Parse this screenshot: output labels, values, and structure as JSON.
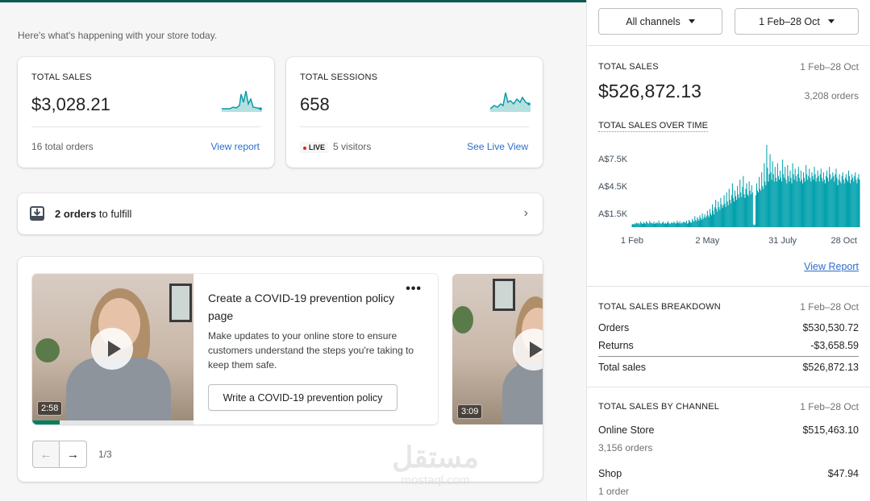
{
  "intro": "Here's what's happening with your store today.",
  "sales_card": {
    "label": "TOTAL SALES",
    "value": "$3,028.21",
    "footer": "16 total orders",
    "link": "View report"
  },
  "sessions_card": {
    "label": "TOTAL SESSIONS",
    "value": "658",
    "live_badge": "LIVE",
    "footer": "5 visitors",
    "link": "See Live View"
  },
  "fulfill": {
    "count_text": "2 orders",
    "rest_text": " to fulfill",
    "icon": "download-tray-icon"
  },
  "promo": {
    "title": "Create a COVID-19 prevention policy page",
    "description": "Make updates to your online store to ensure customers understand the steps you're taking to keep them safe.",
    "button": "Write a COVID-19 prevention policy",
    "video1_duration": "2:58",
    "video2_duration": "3:09",
    "more": "•••",
    "pager": "1/3",
    "prev": "←",
    "next": "→",
    "video_progress": 0.17
  },
  "filters": {
    "channel": "All channels",
    "date": "1 Feb–28 Oct"
  },
  "total_sales": {
    "label": "TOTAL SALES",
    "date": "1 Feb–28 Oct",
    "value": "$526,872.13",
    "orders": "3,208 orders",
    "chart_title": "TOTAL SALES OVER TIME",
    "view_report": "View Report"
  },
  "breakdown": {
    "label": "TOTAL SALES BREAKDOWN",
    "date": "1 Feb–28 Oct",
    "rows": [
      {
        "label": "Orders",
        "value": "$530,530.72"
      },
      {
        "label": "Returns",
        "value": "-$3,658.59"
      },
      {
        "label": "Total sales",
        "value": "$526,872.13"
      }
    ]
  },
  "by_channel": {
    "label": "TOTAL SALES BY CHANNEL",
    "date": "1 Feb–28 Oct",
    "rows": [
      {
        "label": "Online Store",
        "value": "$515,463.10",
        "sub": "3,156 orders"
      },
      {
        "label": "Shop",
        "value": "$47.94",
        "sub": "1 order"
      }
    ]
  },
  "watermark": {
    "logo": "مستقل",
    "url": "mostaql.com"
  },
  "colors": {
    "accent": "#47c1bf",
    "teal": "#00a0ac",
    "link": "#2c6ecb",
    "live": "#d72c0d"
  },
  "chart_data": {
    "type": "bar",
    "ylabel": "",
    "xlabel": "",
    "y_ticks": [
      "A$1.5K",
      "A$4.5K",
      "A$7.5K"
    ],
    "y_tick_values": [
      1500,
      4500,
      7500
    ],
    "x_ticks": [
      "1 Feb",
      "2 May",
      "31 July",
      "28 Oct"
    ],
    "x_tick_index": [
      0,
      90,
      180,
      269
    ],
    "ylim": [
      0,
      9000
    ],
    "grid": false,
    "series": [
      {
        "values": [
          300,
          350,
          280,
          400,
          350,
          500,
          420,
          380,
          450,
          300,
          600,
          480,
          350,
          400,
          550,
          420,
          380,
          650,
          500,
          420,
          380,
          700,
          450,
          500,
          420,
          380,
          600,
          350,
          480,
          420,
          520,
          380,
          700,
          450,
          400,
          380,
          500,
          600,
          420,
          380,
          480,
          350,
          500,
          650,
          420,
          400,
          380,
          520,
          480,
          420,
          600,
          500,
          380,
          450,
          720,
          500,
          420,
          650,
          380,
          500,
          420,
          550,
          600,
          480,
          500,
          700,
          380,
          450,
          800,
          650,
          520,
          480,
          900,
          700,
          600,
          1200,
          800,
          650,
          1100,
          900,
          700,
          1300,
          1000,
          800,
          1500,
          900,
          1100,
          1400,
          1000,
          1200,
          1800,
          1300,
          1100,
          2000,
          1500,
          1300,
          2500,
          1800,
          1400,
          2200,
          3000,
          2000,
          1700,
          2800,
          2200,
          1900,
          3200,
          2500,
          2100,
          2400,
          3500,
          2600,
          2200,
          3800,
          2800,
          2400,
          4200,
          3000,
          2600,
          3500,
          4800,
          3200,
          2800,
          4000,
          3400,
          3000,
          4500,
          3600,
          3200,
          5200,
          3800,
          3300,
          4400,
          5600,
          3600,
          3200,
          4200,
          4800,
          3600,
          3400,
          5000,
          4000,
          3600,
          4600,
          3800,
          300,
          200,
          300,
          3500,
          4800,
          4000,
          3800,
          5500,
          4200,
          4000,
          6000,
          4500,
          4200,
          7000,
          5000,
          4600,
          9000,
          6500,
          5000,
          5800,
          8000,
          6000,
          5200,
          7200,
          5800,
          5000,
          6600,
          5400,
          5000,
          7000,
          5600,
          5200,
          6200,
          5400,
          5000,
          7400,
          5800,
          5400,
          6600,
          5200,
          4800,
          6800,
          5600,
          5000,
          6200,
          5400,
          4800,
          7000,
          5800,
          5200,
          6400,
          5600,
          5000,
          5800,
          6600,
          5400,
          5000,
          6200,
          5200,
          4800,
          6000,
          5400,
          5000,
          6800,
          5800,
          5200,
          5600,
          6400,
          5400,
          5000,
          6000,
          5600,
          5200,
          6600,
          5800,
          5000,
          5400,
          6200,
          5600,
          5000,
          5800,
          6400,
          5400,
          5000,
          6000,
          5200,
          4800,
          5600,
          6200,
          5400,
          5000,
          6600,
          5800,
          5200,
          5400,
          6000,
          5600,
          5000,
          5800,
          6400,
          5400,
          4600,
          5200,
          5800,
          5000,
          4800,
          5600,
          6000,
          5200,
          4800,
          5400,
          5800,
          5200,
          5000,
          6200,
          5600,
          4800,
          5200,
          5800,
          5400,
          5000,
          5600,
          6000,
          5200,
          4800,
          5400,
          5800,
          5200
        ]
      }
    ]
  }
}
